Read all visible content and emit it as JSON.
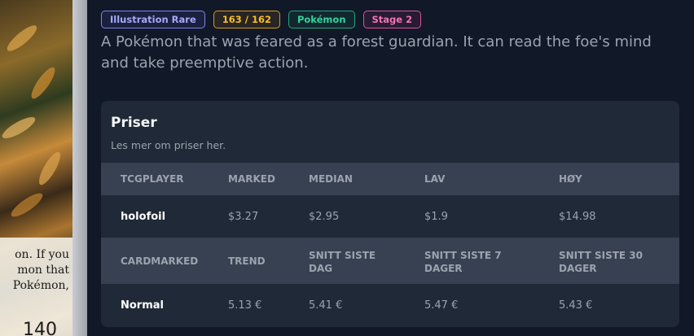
{
  "card": {
    "text_lines": [
      "on. If you",
      "mon that",
      "Pokémon,"
    ],
    "hp_partial": "140",
    "icon": "card-art-image"
  },
  "badges": [
    {
      "label": "Illustration Rare",
      "color": "#818cf8"
    },
    {
      "label": "163 / 162",
      "color": "#fbbf24"
    },
    {
      "label": "Pokémon",
      "color": "#34d399"
    },
    {
      "label": "Stage 2",
      "color": "#f472b6"
    }
  ],
  "description": "A Pokémon that was feared as a forest guardian. It can read the foe's mind and take preemptive action.",
  "prices": {
    "title": "Priser",
    "subtitle": "Les mer om priser her.",
    "tcgplayer": {
      "headers": [
        "TCGPLAYER",
        "MARKED",
        "MEDIAN",
        "LAV",
        "HØY"
      ],
      "rows": [
        {
          "name": "holofoil",
          "market": "$3.27",
          "median": "$2.95",
          "low": "$1.9",
          "high": "$14.98"
        }
      ]
    },
    "cardmarket": {
      "headers": [
        "CARDMARKED",
        "TREND",
        "SNITT SISTE DAG",
        "SNITT SISTE 7 DAGER",
        "SNITT SISTE 30 DAGER"
      ],
      "rows": [
        {
          "name": "Normal",
          "trend": "5.13 €",
          "avg1": "5.41 €",
          "avg7": "5.47 €",
          "avg30": "5.43 €"
        }
      ]
    }
  }
}
